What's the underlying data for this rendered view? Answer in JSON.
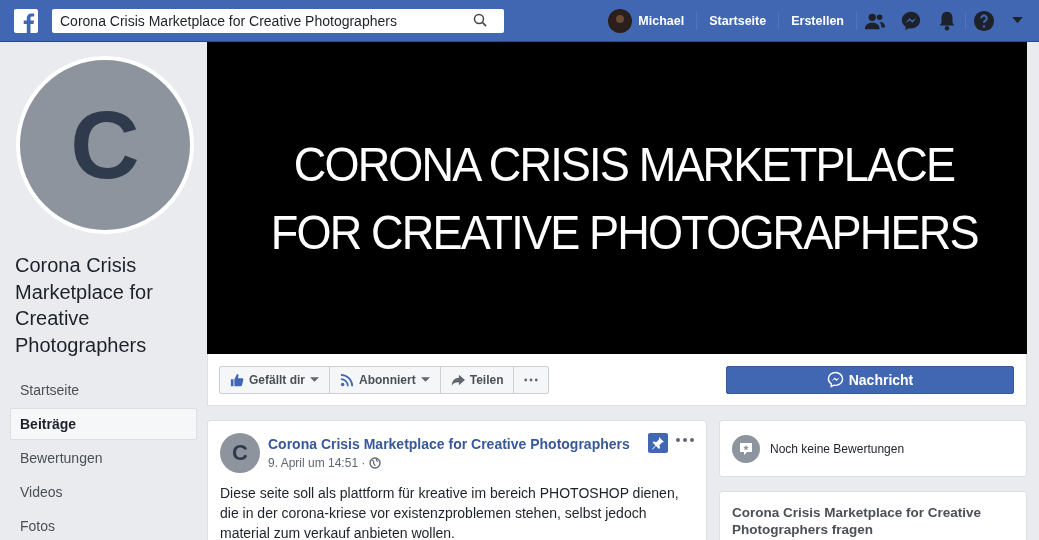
{
  "top_bar": {
    "search": {
      "value": "Corona Crisis Marketplace for Creative Photographers"
    },
    "profile": "Michael",
    "links": [
      "Startseite",
      "Erstellen"
    ]
  },
  "page": {
    "avatar_letter": "C",
    "name": "Corona Crisis Marketplace for Creative Photographers"
  },
  "sidebar": {
    "items": [
      {
        "label": "Startseite",
        "selected": false
      },
      {
        "label": "Beiträge",
        "selected": true
      },
      {
        "label": "Bewertungen",
        "selected": false
      },
      {
        "label": "Videos",
        "selected": false
      },
      {
        "label": "Fotos",
        "selected": false
      }
    ]
  },
  "cover": {
    "lines": [
      "CORONA CRISIS MARKETPLACE",
      "FOR CREATIVE PHOTOGRAPHERS"
    ]
  },
  "actions": [
    {
      "kind": "like",
      "label": "Gefällt dir"
    },
    {
      "kind": "follow",
      "label": "Abonniert"
    },
    {
      "kind": "share",
      "label": "Teilen"
    },
    {
      "kind": "more"
    }
  ],
  "message_button": "Nachricht",
  "post": {
    "avatar_letter": "C",
    "author": "Corona Crisis Marketplace for Creative Photographers",
    "time": "9. April um 14:51 ·",
    "pinned": true,
    "text": "Diese seite soll als plattform für kreative im bereich PHOTOSHOP dienen, die in der corona-kriese vor existenzproblemen stehen, selbst jedoch material zum verkauf anbieten wollen."
  },
  "reviews": {
    "text": "Noch keine Bewertungen"
  },
  "ask": {
    "title": "Corona Crisis Marketplace for Creative Photographers fragen"
  }
}
